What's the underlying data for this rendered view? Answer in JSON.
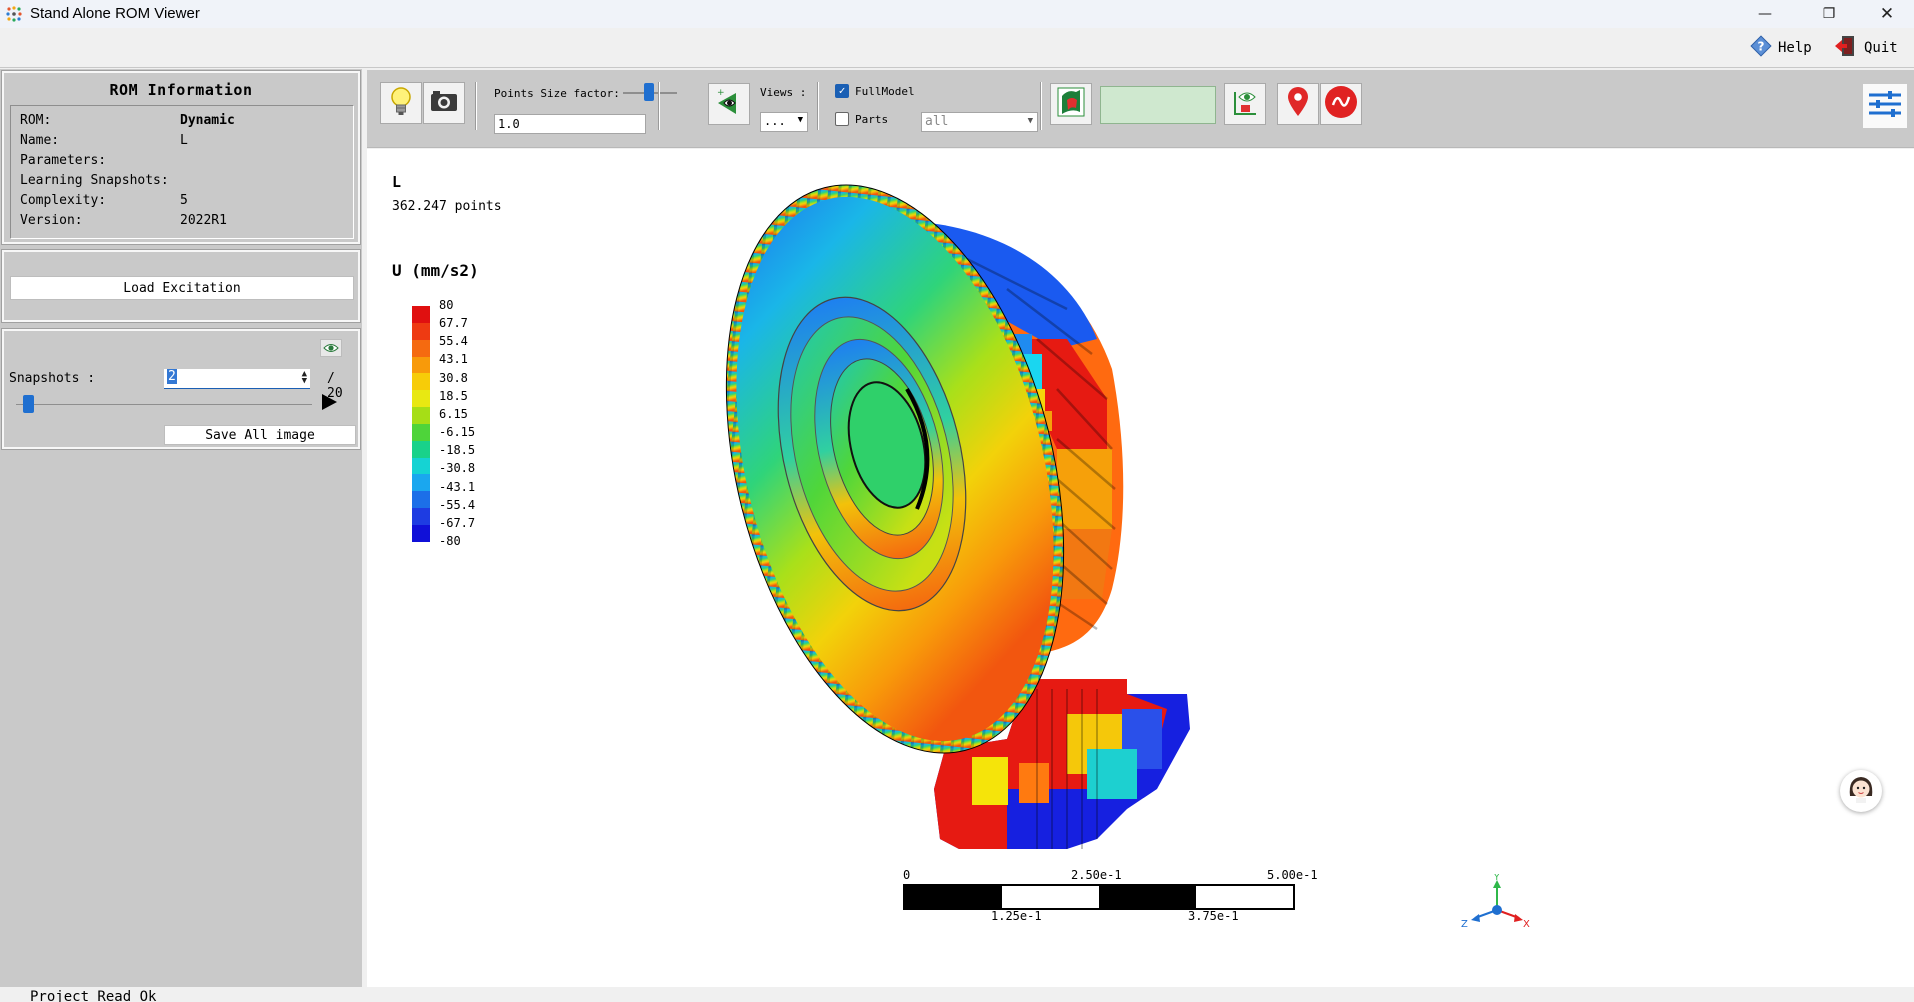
{
  "window": {
    "title": "Stand Alone ROM Viewer",
    "minimize_glyph": "—",
    "maximize_glyph": "❐",
    "close_glyph": "✕"
  },
  "menubar": {
    "help_label": "Help",
    "quit_label": "Quit"
  },
  "rom_info": {
    "heading": "ROM Information",
    "rows": [
      {
        "key": "ROM:",
        "value": "Dynamic"
      },
      {
        "key": "Name:",
        "value": "L"
      },
      {
        "key": "Parameters:",
        "value": ""
      },
      {
        "key": "Learning Snapshots:",
        "value": ""
      },
      {
        "key": "Complexity:",
        "value": "5"
      },
      {
        "key": "Version:",
        "value": "2022R1"
      }
    ]
  },
  "excitation": {
    "load_label": "Load Excitation"
  },
  "snapshots": {
    "label": "Snapshots :",
    "current": "2",
    "total": "/ 20",
    "slider_position": 0.05,
    "save_all_label": "Save All image"
  },
  "toolbar": {
    "points_size_label": "Points Size factor:",
    "points_size_value": "1.0",
    "views_label": "Views :",
    "views_value": "...",
    "fullmodel_label": "FullModel",
    "fullmodel_checked": true,
    "parts_label": "Parts",
    "parts_checked": false,
    "parts_value": "all",
    "icons": [
      "lightbulb-icon",
      "camera-icon",
      "view-add-icon",
      "model-map-icon",
      "eye-view-icon",
      "location-pin-icon",
      "probe-icon",
      "settings-sliders-icon"
    ]
  },
  "viewport": {
    "model_name": "L",
    "points_count": "362.247 points",
    "legend_title": "U (mm/s2)",
    "legend_labels": [
      "80",
      "67.7",
      "55.4",
      "43.1",
      "30.8",
      "18.5",
      "6.15",
      "-6.15",
      "-18.5",
      "-30.8",
      "-43.1",
      "-55.4",
      "-67.7",
      "-80"
    ],
    "legend_colors": [
      "#e01010",
      "#ee3a12",
      "#f56a10",
      "#f89a0a",
      "#f7cc08",
      "#e8e812",
      "#a6de16",
      "#4ed43a",
      "#19d28a",
      "#15d3d3",
      "#1aa7ef",
      "#1c6fe8",
      "#1e3ce2",
      "#1010d8"
    ],
    "scale_top_labels": [
      "0",
      "2.50e-1",
      "5.00e-1"
    ],
    "scale_bottom_labels": [
      "1.25e-1",
      "3.75e-1"
    ],
    "axes": {
      "x": "X",
      "y": "Y",
      "z": "Z"
    }
  },
  "status": {
    "text": "Project Read Ok"
  }
}
